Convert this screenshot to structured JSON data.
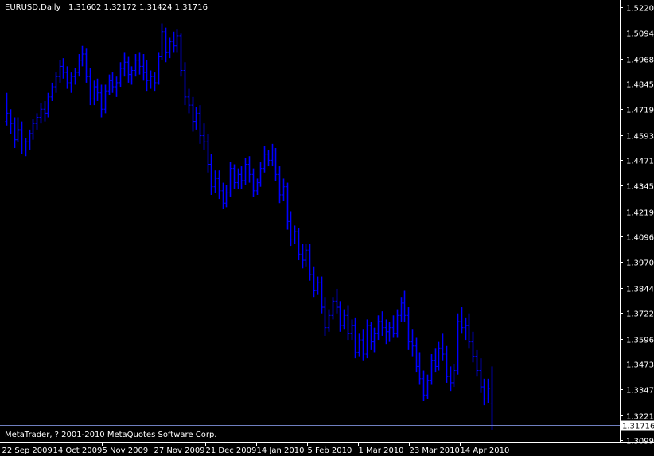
{
  "header": {
    "symbol": "EURUSD,Daily",
    "ohlc": [
      "1.31602",
      "1.32172",
      "1.31424",
      "1.31716"
    ]
  },
  "footer": {
    "copyright": "MetaTrader, ? 2001-2010 MetaQuotes Software Corp."
  },
  "colors": {
    "background": "#000000",
    "bars": "#0000ff",
    "axis": "#ffffff",
    "last_line": "#6f7fbf",
    "last_price_box": "#ffffff",
    "last_price_text": "#000000"
  },
  "chart_data": {
    "type": "ohlc",
    "title": "EURUSD,Daily",
    "last_price": "1.31716",
    "y_ticks": [
      "1.52200",
      "1.50940",
      "1.49680",
      "1.48455",
      "1.47195",
      "1.45935",
      "1.44710",
      "1.43450",
      "1.42190",
      "1.40965",
      "1.39705",
      "1.38445",
      "1.37220",
      "1.35960",
      "1.34735",
      "1.33475",
      "1.32215",
      "1.30990"
    ],
    "x_ticks": [
      "22 Sep 2009",
      "14 Oct 2009",
      "5 Nov 2009",
      "27 Nov 2009",
      "21 Dec 2009",
      "14 Jan 2010",
      "5 Feb 2010",
      "1 Mar 2010",
      "23 Mar 2010",
      "14 Apr 2010"
    ],
    "ylim": [
      1.3099,
      1.522
    ],
    "grid": false,
    "bars": [
      [
        1.466,
        1.48,
        1.464,
        1.47
      ],
      [
        1.47,
        1.472,
        1.46,
        1.465
      ],
      [
        1.465,
        1.468,
        1.453,
        1.457
      ],
      [
        1.457,
        1.468,
        1.456,
        1.462
      ],
      [
        1.462,
        1.466,
        1.45,
        1.452
      ],
      [
        1.452,
        1.458,
        1.449,
        1.456
      ],
      [
        1.456,
        1.462,
        1.452,
        1.46
      ],
      [
        1.46,
        1.467,
        1.457,
        1.465
      ],
      [
        1.465,
        1.47,
        1.462,
        1.468
      ],
      [
        1.468,
        1.475,
        1.465,
        1.472
      ],
      [
        1.472,
        1.476,
        1.466,
        1.47
      ],
      [
        1.47,
        1.48,
        1.468,
        1.478
      ],
      [
        1.478,
        1.485,
        1.476,
        1.483
      ],
      [
        1.483,
        1.49,
        1.48,
        1.488
      ],
      [
        1.488,
        1.496,
        1.485,
        1.493
      ],
      [
        1.493,
        1.497,
        1.487,
        1.49
      ],
      [
        1.49,
        1.493,
        1.482,
        1.485
      ],
      [
        1.485,
        1.49,
        1.48,
        1.488
      ],
      [
        1.488,
        1.492,
        1.484,
        1.49
      ],
      [
        1.49,
        1.499,
        1.488,
        1.496
      ],
      [
        1.496,
        1.503,
        1.493,
        1.499
      ],
      [
        1.499,
        1.502,
        1.485,
        1.488
      ],
      [
        1.488,
        1.492,
        1.474,
        1.477
      ],
      [
        1.477,
        1.486,
        1.474,
        1.483
      ],
      [
        1.483,
        1.487,
        1.476,
        1.48
      ],
      [
        1.48,
        1.484,
        1.468,
        1.472
      ],
      [
        1.472,
        1.484,
        1.47,
        1.481
      ],
      [
        1.481,
        1.489,
        1.479,
        1.486
      ],
      [
        1.486,
        1.49,
        1.48,
        1.483
      ],
      [
        1.483,
        1.488,
        1.478,
        1.485
      ],
      [
        1.485,
        1.495,
        1.483,
        1.492
      ],
      [
        1.492,
        1.5,
        1.488,
        1.495
      ],
      [
        1.495,
        1.498,
        1.485,
        1.489
      ],
      [
        1.489,
        1.493,
        1.484,
        1.491
      ],
      [
        1.491,
        1.499,
        1.488,
        1.496
      ],
      [
        1.496,
        1.5,
        1.489,
        1.493
      ],
      [
        1.493,
        1.499,
        1.486,
        1.49
      ],
      [
        1.49,
        1.496,
        1.481,
        1.486
      ],
      [
        1.486,
        1.491,
        1.482,
        1.488
      ],
      [
        1.488,
        1.49,
        1.481,
        1.485
      ],
      [
        1.485,
        1.5,
        1.484,
        1.498
      ],
      [
        1.498,
        1.514,
        1.496,
        1.51
      ],
      [
        1.51,
        1.512,
        1.495,
        1.5
      ],
      [
        1.5,
        1.507,
        1.497,
        1.505
      ],
      [
        1.505,
        1.51,
        1.5,
        1.503
      ],
      [
        1.503,
        1.511,
        1.5,
        1.508
      ],
      [
        1.508,
        1.509,
        1.488,
        1.491
      ],
      [
        1.491,
        1.495,
        1.474,
        1.478
      ],
      [
        1.478,
        1.482,
        1.47,
        1.474
      ],
      [
        1.474,
        1.478,
        1.461,
        1.466
      ],
      [
        1.466,
        1.473,
        1.462,
        1.47
      ],
      [
        1.47,
        1.474,
        1.455,
        1.459
      ],
      [
        1.459,
        1.465,
        1.452,
        1.456
      ],
      [
        1.456,
        1.46,
        1.441,
        1.445
      ],
      [
        1.445,
        1.45,
        1.43,
        1.434
      ],
      [
        1.434,
        1.442,
        1.431,
        1.438
      ],
      [
        1.438,
        1.442,
        1.428,
        1.432
      ],
      [
        1.432,
        1.436,
        1.423,
        1.426
      ],
      [
        1.426,
        1.435,
        1.424,
        1.431
      ],
      [
        1.431,
        1.446,
        1.429,
        1.443
      ],
      [
        1.443,
        1.445,
        1.433,
        1.436
      ],
      [
        1.436,
        1.443,
        1.433,
        1.44
      ],
      [
        1.44,
        1.444,
        1.433,
        1.437
      ],
      [
        1.437,
        1.448,
        1.435,
        1.445
      ],
      [
        1.445,
        1.449,
        1.436,
        1.44
      ],
      [
        1.44,
        1.443,
        1.429,
        1.432
      ],
      [
        1.432,
        1.438,
        1.43,
        1.436
      ],
      [
        1.436,
        1.446,
        1.434,
        1.443
      ],
      [
        1.443,
        1.454,
        1.441,
        1.45
      ],
      [
        1.45,
        1.452,
        1.444,
        1.447
      ],
      [
        1.447,
        1.455,
        1.444,
        1.452
      ],
      [
        1.452,
        1.453,
        1.437,
        1.44
      ],
      [
        1.44,
        1.444,
        1.426,
        1.43
      ],
      [
        1.43,
        1.438,
        1.427,
        1.434
      ],
      [
        1.434,
        1.436,
        1.413,
        1.417
      ],
      [
        1.417,
        1.422,
        1.405,
        1.408
      ],
      [
        1.408,
        1.415,
        1.406,
        1.412
      ],
      [
        1.412,
        1.414,
        1.398,
        1.401
      ],
      [
        1.401,
        1.406,
        1.394,
        1.398
      ],
      [
        1.398,
        1.406,
        1.395,
        1.403
      ],
      [
        1.403,
        1.406,
        1.388,
        1.391
      ],
      [
        1.391,
        1.395,
        1.38,
        1.383
      ],
      [
        1.383,
        1.39,
        1.381,
        1.387
      ],
      [
        1.387,
        1.39,
        1.372,
        1.375
      ],
      [
        1.375,
        1.38,
        1.361,
        1.365
      ],
      [
        1.365,
        1.374,
        1.363,
        1.371
      ],
      [
        1.371,
        1.38,
        1.369,
        1.378
      ],
      [
        1.378,
        1.384,
        1.372,
        1.375
      ],
      [
        1.375,
        1.378,
        1.363,
        1.366
      ],
      [
        1.366,
        1.374,
        1.364,
        1.371
      ],
      [
        1.371,
        1.376,
        1.359,
        1.362
      ],
      [
        1.362,
        1.369,
        1.359,
        1.366
      ],
      [
        1.366,
        1.37,
        1.35,
        1.353
      ],
      [
        1.353,
        1.362,
        1.351,
        1.359
      ],
      [
        1.359,
        1.364,
        1.349,
        1.352
      ],
      [
        1.352,
        1.369,
        1.35,
        1.366
      ],
      [
        1.366,
        1.368,
        1.354,
        1.358
      ],
      [
        1.358,
        1.365,
        1.353,
        1.362
      ],
      [
        1.362,
        1.371,
        1.359,
        1.368
      ],
      [
        1.368,
        1.373,
        1.361,
        1.365
      ],
      [
        1.365,
        1.369,
        1.357,
        1.363
      ],
      [
        1.363,
        1.368,
        1.358,
        1.365
      ],
      [
        1.365,
        1.371,
        1.36,
        1.362
      ],
      [
        1.362,
        1.374,
        1.36,
        1.371
      ],
      [
        1.371,
        1.38,
        1.368,
        1.377
      ],
      [
        1.377,
        1.383,
        1.368,
        1.371
      ],
      [
        1.371,
        1.375,
        1.354,
        1.358
      ],
      [
        1.358,
        1.364,
        1.351,
        1.356
      ],
      [
        1.356,
        1.36,
        1.343,
        1.346
      ],
      [
        1.346,
        1.353,
        1.337,
        1.34
      ],
      [
        1.34,
        1.344,
        1.329,
        1.332
      ],
      [
        1.332,
        1.342,
        1.33,
        1.339
      ],
      [
        1.339,
        1.352,
        1.337,
        1.349
      ],
      [
        1.349,
        1.355,
        1.343,
        1.346
      ],
      [
        1.346,
        1.358,
        1.344,
        1.355
      ],
      [
        1.355,
        1.362,
        1.349,
        1.352
      ],
      [
        1.352,
        1.356,
        1.338,
        1.341
      ],
      [
        1.341,
        1.346,
        1.334,
        1.338
      ],
      [
        1.338,
        1.347,
        1.336,
        1.344
      ],
      [
        1.344,
        1.372,
        1.342,
        1.368
      ],
      [
        1.368,
        1.375,
        1.362,
        1.365
      ],
      [
        1.365,
        1.37,
        1.359,
        1.366
      ],
      [
        1.366,
        1.372,
        1.355,
        1.358
      ],
      [
        1.358,
        1.363,
        1.348,
        1.351
      ],
      [
        1.351,
        1.354,
        1.341,
        1.344
      ],
      [
        1.344,
        1.35,
        1.333,
        1.336
      ],
      [
        1.336,
        1.34,
        1.327,
        1.33
      ],
      [
        1.33,
        1.34,
        1.328,
        1.335
      ],
      [
        1.328,
        1.346,
        1.315,
        1.31716
      ]
    ]
  }
}
